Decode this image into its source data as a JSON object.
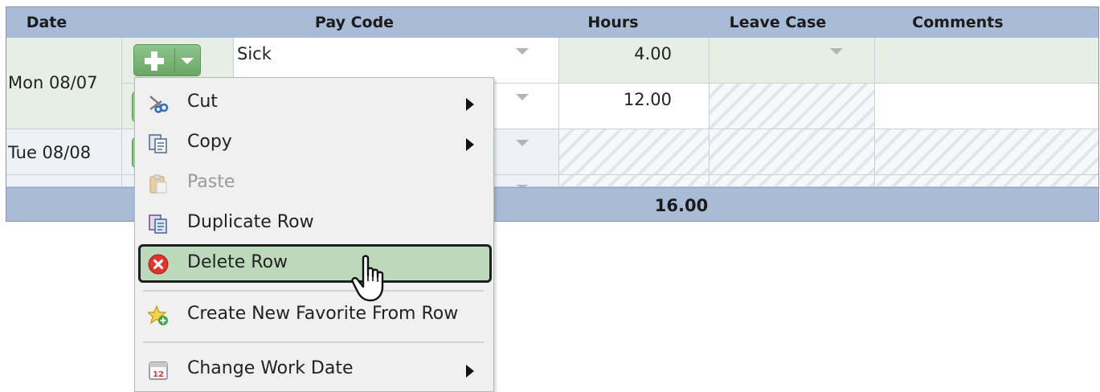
{
  "grid": {
    "columns": [
      "Date",
      "Pay Code",
      "Hours",
      "Leave Case",
      "Comments"
    ],
    "rows": [
      {
        "date": "Mon 08/07",
        "pay_code": "Sick",
        "hours": "4.00"
      },
      {
        "date": "",
        "pay_code": "",
        "hours": "12.00"
      },
      {
        "date": "Tue 08/08",
        "pay_code": "",
        "hours": ""
      }
    ],
    "total_hours": "16.00"
  },
  "context_menu": {
    "items": [
      {
        "label": "Cut",
        "icon": "scissors-icon",
        "submenu": true
      },
      {
        "label": "Copy",
        "icon": "copy-icon",
        "submenu": true
      },
      {
        "label": "Paste",
        "icon": "paste-icon",
        "disabled": true
      },
      {
        "label": "Duplicate Row",
        "icon": "duplicate-icon"
      },
      {
        "label": "Delete Row",
        "icon": "delete-icon",
        "hovered": true
      },
      {
        "label": "Create New Favorite From Row",
        "icon": "star-add-icon"
      },
      {
        "label": "Change Work Date",
        "icon": "calendar-icon",
        "submenu": true
      }
    ],
    "calendar_icon_day": "12"
  },
  "colors": {
    "header_bg": "#a8bcd8",
    "row_green": "#e7efe5",
    "add_button": "#6aa666",
    "hover_item_bg": "#bcd9bb",
    "delete_red": "#e0342b"
  }
}
